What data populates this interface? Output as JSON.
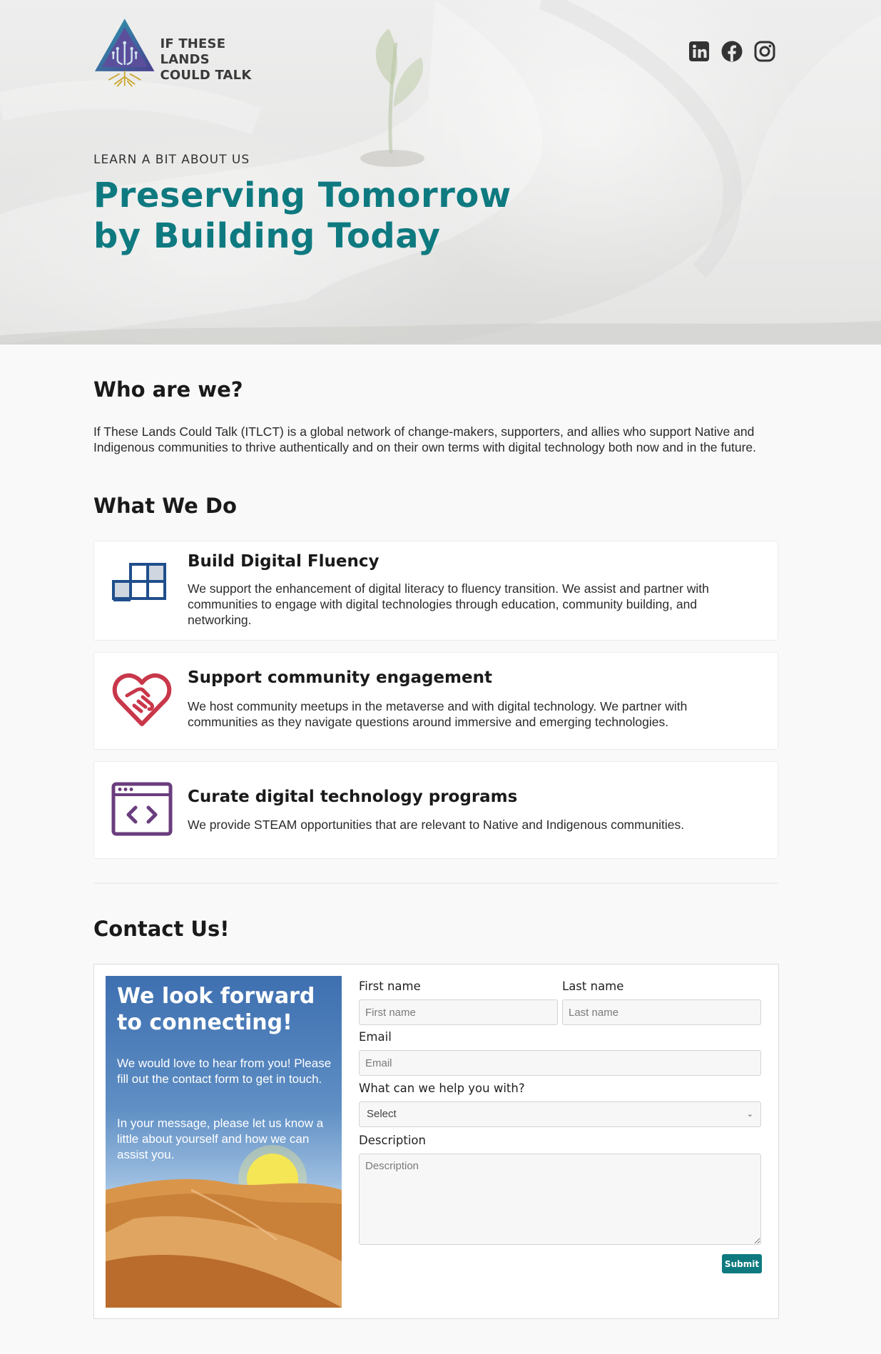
{
  "brand": {
    "name_line1": "IF THESE LANDS",
    "name_line2": "COULD TALK"
  },
  "social": [
    {
      "icon": "linkedin-icon"
    },
    {
      "icon": "facebook-icon"
    },
    {
      "icon": "instagram-icon"
    }
  ],
  "hero": {
    "kicker": "LEARN A BIT ABOUT US",
    "title": "Preserving Tomorrow by Building Today"
  },
  "about": {
    "heading": "Who are we?",
    "text": "If These Lands Could Talk (ITLCT) is a global network of change-makers, supporters, and allies who support Native and Indigenous communities to thrive authentically and on their own terms with digital technology both now and in the future."
  },
  "services": {
    "heading": "What We Do",
    "items": [
      {
        "icon": "blocks-icon",
        "title": "Build Digital Fluency",
        "text": "We support the enhancement of digital literacy to fluency transition. We assist and partner with communities to engage with digital technologies through education, community building, and networking."
      },
      {
        "icon": "heart-handshake-icon",
        "title": "Support community engagement",
        "text": "We host community meetups in the metaverse and with digital technology. We partner with communities as they navigate questions around immersive and emerging technologies."
      },
      {
        "icon": "code-window-icon",
        "title": "Curate digital technology programs",
        "text": "We provide STEAM opportunities that are relevant to Native and Indigenous communities."
      }
    ]
  },
  "contact": {
    "heading": "Contact Us!",
    "promo": {
      "heading": "We look forward to connecting!",
      "p1": "We would love to hear from you! Please fill out the contact form to get in touch.",
      "p2": "In your message, please let us know a little about yourself and how we can assist you."
    },
    "form": {
      "first_name_label": "First name",
      "first_name_placeholder": "First name",
      "last_name_label": "Last name",
      "last_name_placeholder": "Last name",
      "email_label": "Email",
      "email_placeholder": "Email",
      "help_label": "What can we help you with?",
      "help_selected": "Select",
      "description_label": "Description",
      "description_placeholder": "Description",
      "submit_label": "Submit"
    }
  },
  "colors": {
    "accent": "#0e7a80",
    "icon_blue": "#1f4e8c",
    "icon_red": "#c8374a",
    "icon_purple": "#6a3d7e"
  }
}
